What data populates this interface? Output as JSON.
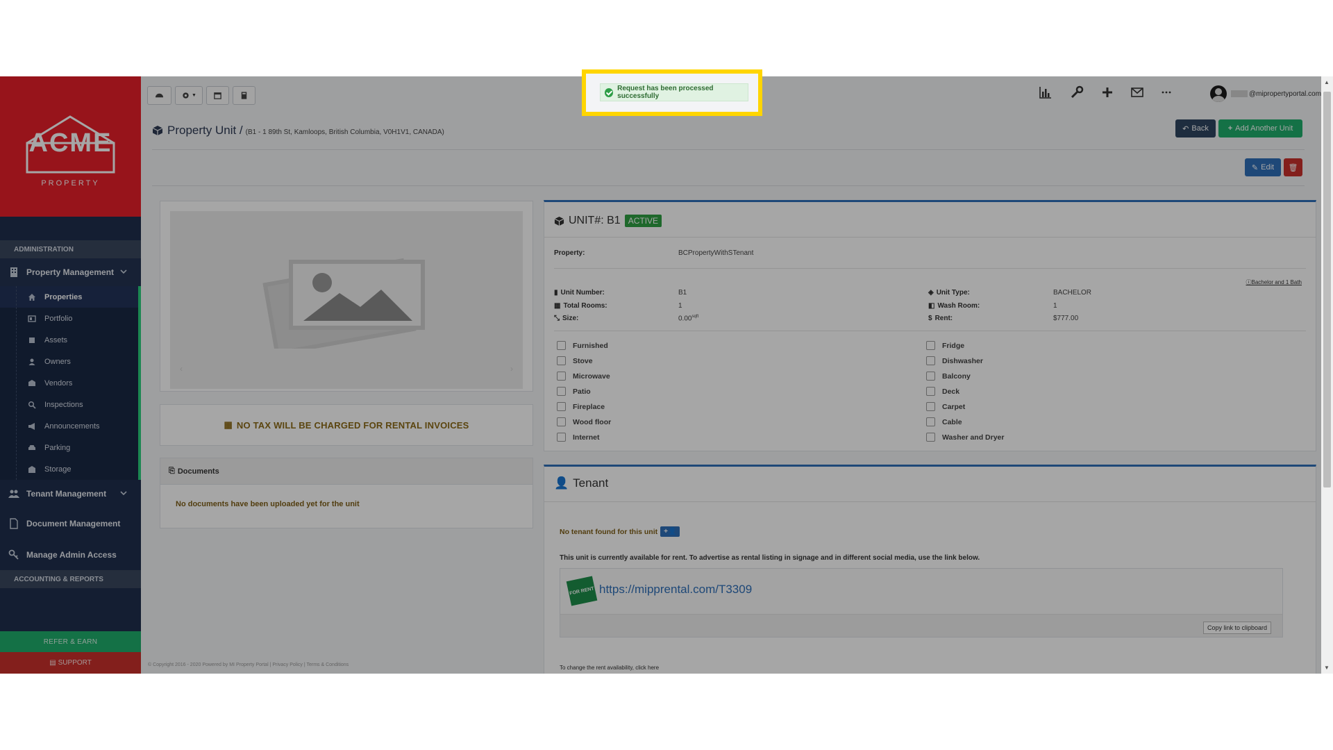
{
  "brand": {
    "logo_main": "ACME",
    "logo_sub": "PROPERTY"
  },
  "notification": {
    "message": "Request has been processed successfully"
  },
  "sidebar": {
    "admin_header": "ADMINISTRATION",
    "property_management": "Property Management",
    "items": [
      {
        "label": "Properties",
        "icon": "home-icon"
      },
      {
        "label": "Portfolio",
        "icon": "portfolio-icon"
      },
      {
        "label": "Assets",
        "icon": "assets-icon"
      },
      {
        "label": "Owners",
        "icon": "user-icon"
      },
      {
        "label": "Vendors",
        "icon": "vendor-icon"
      },
      {
        "label": "Inspections",
        "icon": "search-icon"
      },
      {
        "label": "Announcements",
        "icon": "megaphone-icon"
      },
      {
        "label": "Parking",
        "icon": "car-icon"
      },
      {
        "label": "Storage",
        "icon": "storage-icon"
      }
    ],
    "tenant_management": "Tenant Management",
    "document_management": "Document Management",
    "manage_admin_access": "Manage Admin Access",
    "accounting_header": "ACCOUNTING & REPORTS",
    "refer": "REFER & EARN",
    "support": "SUPPORT"
  },
  "topbar": {
    "user_email": "@mipropertyportal.com"
  },
  "header": {
    "title": "Property Unit /",
    "address": "(B1 - 1 89th St, Kamloops, British Columbia, V0H1V1, CANADA)",
    "back": "Back",
    "add_unit": "Add Another Unit",
    "edit": "Edit"
  },
  "tax_notice": "NO TAX WILL BE CHARGED FOR RENTAL INVOICES",
  "documents": {
    "title": "Documents",
    "empty": "No documents have been uploaded yet for the unit"
  },
  "unit": {
    "title": "UNIT#: B1",
    "status": "ACTIVE",
    "property_label": "Property:",
    "property_value": "BCPropertyWithSTenant",
    "desc_link": "Bachelor and 1 Bath",
    "unit_number_label": "Unit Number:",
    "unit_number": "B1",
    "total_rooms_label": "Total Rooms:",
    "total_rooms": "1",
    "size_label": "Size:",
    "size": "0.00",
    "size_unit": "sqft",
    "unit_type_label": "Unit Type:",
    "unit_type": "BACHELOR",
    "wash_room_label": "Wash Room:",
    "wash_room": "1",
    "rent_label": "Rent:",
    "rent": "$777.00",
    "amenities_left": [
      "Furnished",
      "Stove",
      "Microwave",
      "Patio",
      "Fireplace",
      "Wood floor",
      "Internet"
    ],
    "amenities_right": [
      "Fridge",
      "Dishwasher",
      "Balcony",
      "Deck",
      "Carpet",
      "Cable",
      "Washer and Dryer"
    ]
  },
  "tenant": {
    "title": "Tenant",
    "none": "No tenant found for this unit",
    "available": "This unit is currently available for rent. To advertise as rental listing in signage and in different social media, use the link below.",
    "link": "https://mipprental.com/T3309",
    "copy": "Copy link to clipboard",
    "for_rent": "FOR RENT",
    "change_note": "To change the rent availability, click here"
  },
  "footer": "© Copyright 2016 - 2020 Powered by MI Property Portal | Privacy Policy | Terms & Conditions"
}
